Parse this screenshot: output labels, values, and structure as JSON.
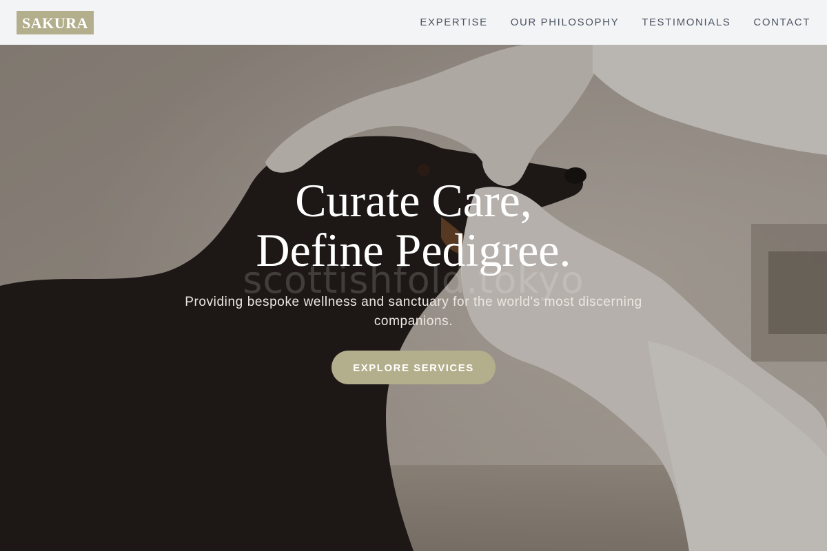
{
  "header": {
    "logo_text": "SAKURA",
    "nav": [
      {
        "label": "EXPERTISE"
      },
      {
        "label": "OUR PHILOSOPHY"
      },
      {
        "label": "TESTIMONIALS"
      },
      {
        "label": "CONTACT"
      }
    ]
  },
  "hero": {
    "title_line1": "Curate Care,",
    "title_line2": "Define Pedigree.",
    "subtitle": "Providing bespoke wellness and sanctuary for the world's most discerning companions.",
    "cta_label": "EXPLORE SERVICES",
    "watermark_text": "scottishfold.tokyo",
    "photo_subject": "veterinarian-gloved-hands-examining-dachshund"
  },
  "colors": {
    "accent": "#b3ae8c",
    "nav_bg": "#f3f4f6",
    "nav_text": "#4b5563",
    "hero_text": "#ffffff"
  }
}
